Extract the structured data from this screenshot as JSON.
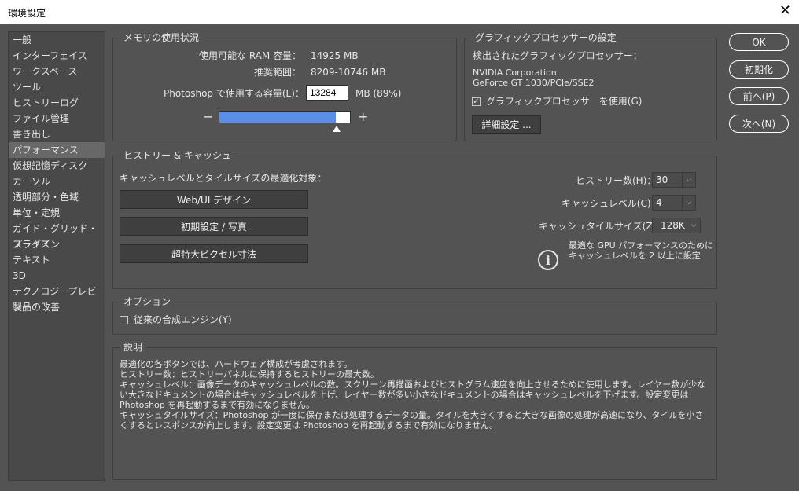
{
  "window": {
    "title": "環境設定",
    "close_glyph": "✕"
  },
  "sidebar": {
    "items": [
      {
        "label": "一般"
      },
      {
        "label": "インターフェイス"
      },
      {
        "label": "ワークスペース"
      },
      {
        "label": "ツール"
      },
      {
        "label": "ヒストリーログ"
      },
      {
        "label": "ファイル管理"
      },
      {
        "label": "書き出し"
      },
      {
        "label": "パフォーマンス",
        "selected": true
      },
      {
        "label": "仮想記憶ディスク"
      },
      {
        "label": "カーソル"
      },
      {
        "label": "透明部分・色域"
      },
      {
        "label": "単位・定規"
      },
      {
        "label": "ガイド・グリッド・スライス"
      },
      {
        "label": "プラグイン"
      },
      {
        "label": "テキスト"
      },
      {
        "label": "3D"
      },
      {
        "label": "テクノロジープレビュー"
      },
      {
        "label": "製品の改善"
      }
    ]
  },
  "memory": {
    "title": "メモリの使用状況",
    "available_label": "使用可能な RAM 容量：",
    "available_value": "14925 MB",
    "recommended_label": "推奨範囲：",
    "recommended_value": "8209-10746 MB",
    "usage_label": "Photoshop で使用する容量(L)：",
    "usage_value": "13284",
    "usage_unit": "MB (89%)",
    "slider_fraction": 0.89,
    "minus": "−",
    "plus": "+"
  },
  "gpu": {
    "title": "グラフィックプロセッサーの設定",
    "detected_label": "検出されたグラフィックプロセッサー：",
    "vendor": "NVIDIA Corporation",
    "model": "GeForce GT 1030/PCIe/SSE2",
    "use_gpu_label": "グラフィックプロセッサーを使用(G)",
    "use_gpu_checked": true,
    "advanced_button": "詳細設定 ..."
  },
  "history_cache": {
    "title": "ヒストリー & キャッシュ",
    "optimize_label": "キャッシュレベルとタイルサイズの最適化対象：",
    "buttons": [
      "Web/UI デザイン",
      "初期設定 / 写真",
      "超特大ピクセル寸法"
    ],
    "history_states_label": "ヒストリー数(H)：",
    "history_states_value": "30",
    "cache_levels_label": "キャッシュレベル(C)：",
    "cache_levels_value": "4",
    "tile_size_label": "キャッシュタイルサイズ(Z)：",
    "tile_size_value": "128K",
    "gpu_note_line1": "最適な GPU パフォーマンスのために",
    "gpu_note_line2": "キャッシュレベルを 2 以上に設定"
  },
  "options": {
    "title": "オプション",
    "legacy_compositing_label": "従来の合成エンジン(Y)",
    "legacy_compositing_checked": false
  },
  "description": {
    "title": "説明",
    "lines": [
      "最適化の各ボタンでは、ハードウェア構成が考慮されます。",
      "ヒストリー数：ヒストリーパネルに保持するヒストリーの最大数。",
      "キャッシュレベル：画像データのキャッシュレベルの数。スクリーン再描画およびヒストグラム速度を向上させるために使用します。レイヤー数が少ない大きなドキュメントの場合はキャッシュレベルを上げ、レイヤー数が多い小さなドキュメントの場合はキャッシュレベルを下げます。設定変更は Photoshop を再起動するまで有効になりません。",
      "キャッシュタイルサイズ：Photoshop が一度に保存または処理するデータの量。タイルを大きくすると大きな画像の処理が高速になり、タイルを小さくするとレスポンスが向上します。設定変更は Photoshop を再起動するまで有効になりません。"
    ]
  },
  "actions": {
    "ok": "OK",
    "reset": "初期化",
    "prev": "前へ(P)",
    "next": "次へ(N)"
  }
}
